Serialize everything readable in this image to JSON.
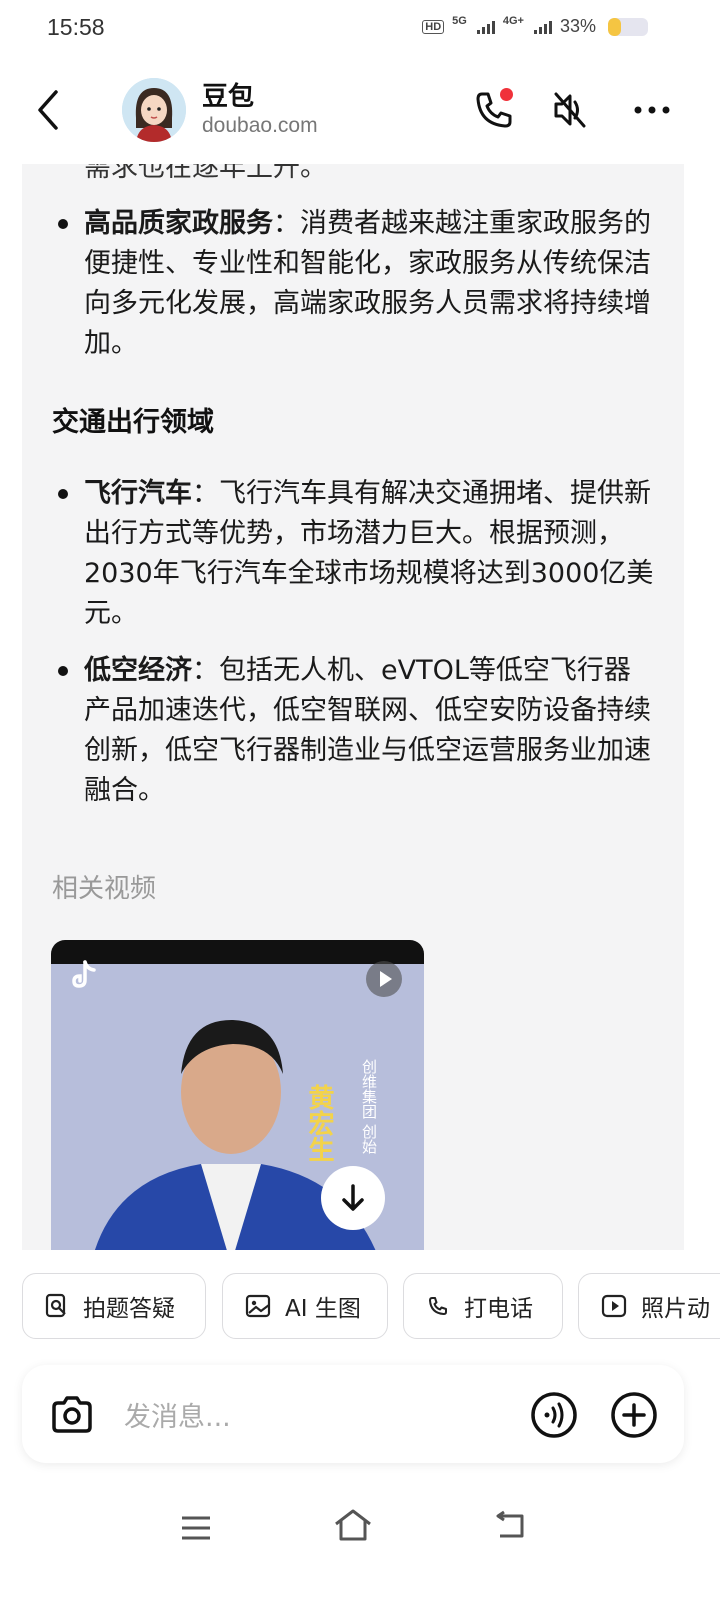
{
  "status_bar": {
    "time": "15:58",
    "network_5g": "5G",
    "network_4g": "4G+",
    "battery_percent": "33%",
    "battery_level": 0.33
  },
  "header": {
    "name": "豆包",
    "subtitle": "doubao.com"
  },
  "content": {
    "truncated_line": "需求也在逐年上升。",
    "housekeeping": {
      "title": "高品质家政服务",
      "text": "：消费者越来越注重家政服务的便捷性、专业性和智能化，家政服务从传统保洁向多元化发展，高端家政服务人员需求将持续增加。"
    },
    "transport_heading": "交通出行领域",
    "items": [
      {
        "title": "飞行汽车",
        "text": "：飞行汽车具有解决交通拥堵、提供新出行方式等优势，市场潜力巨大。根据预测，2030年飞行汽车全球市场规模将达到3000亿美元。"
      },
      {
        "title": "低空经济",
        "text": "：包括无人机、eVTOL等低空飞行器产品加速迭代，低空智联网、低空安防设备持续创新，低空飞行器制造业与低空运营服务业加速融合。"
      }
    ],
    "related_videos_label": "相关视频",
    "video": {
      "caption_name": "黄宏生",
      "caption_org": "创维集团 创始"
    }
  },
  "quick_actions": [
    {
      "label": "拍题答疑",
      "icon": "photo-question-icon"
    },
    {
      "label": "AI 生图",
      "icon": "image-icon"
    },
    {
      "label": "打电话",
      "icon": "phone-icon"
    },
    {
      "label": "照片动",
      "icon": "play-icon"
    }
  ],
  "input": {
    "placeholder": "发消息..."
  }
}
